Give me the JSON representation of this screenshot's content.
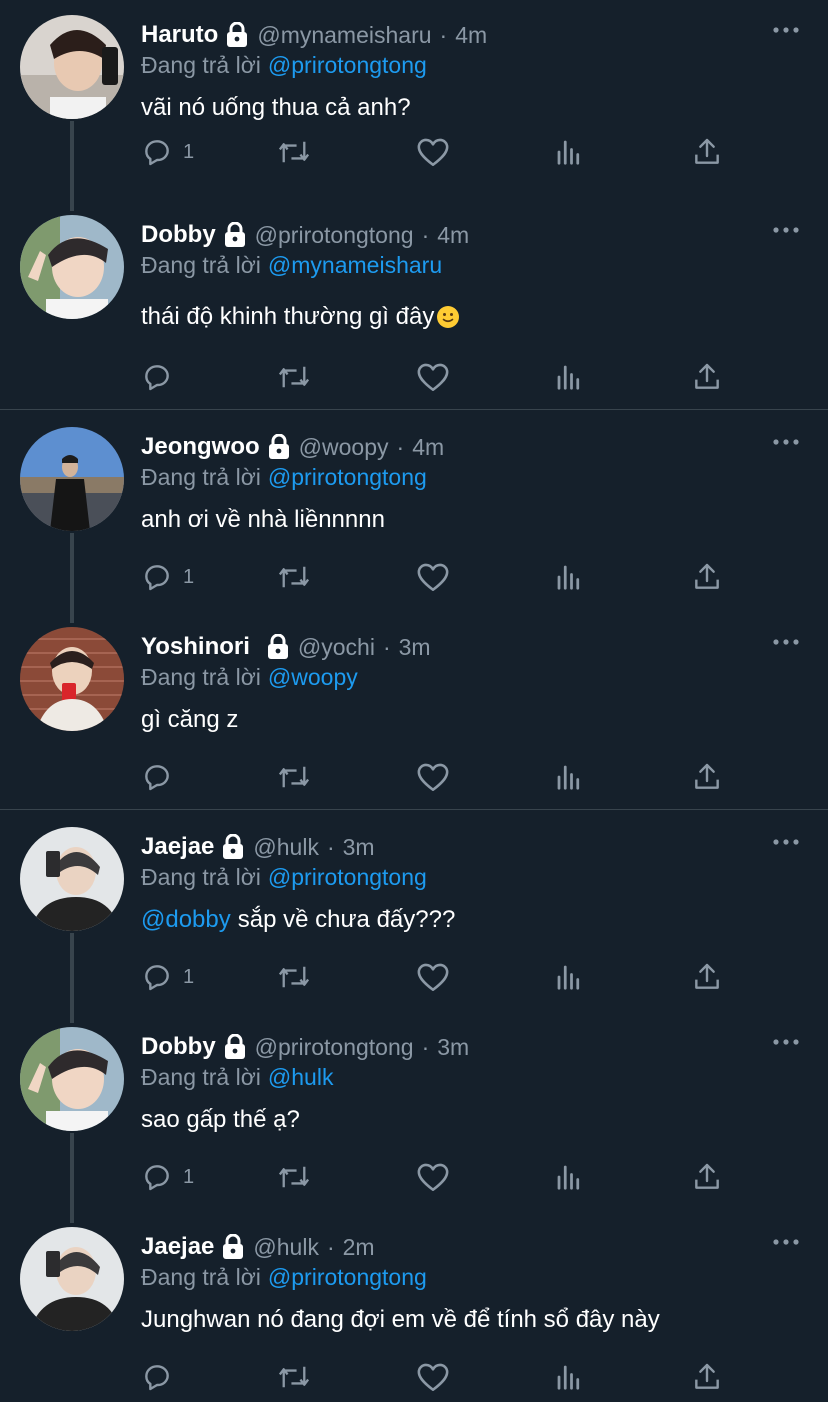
{
  "colors": {
    "background": "#15202b",
    "accent": "#1d9bf0",
    "secondary_text": "#8b98a5",
    "divider": "#38444d"
  },
  "reply_prefix": "Đang trả lời",
  "tweets": [
    {
      "name": "Haruto",
      "handle": "@mynameisharu",
      "time": "4m",
      "replying_to": "@prirotongtong",
      "text": "vãi nó uống thua cả anh?",
      "reply_count": "1"
    },
    {
      "name": "Dobby",
      "handle": "@prirotongtong",
      "time": "4m",
      "replying_to": "@mynameisharu",
      "text": "thái độ khinh thường gì đây",
      "text_emoji": "slightly-smiling-face",
      "reply_count": ""
    },
    {
      "name": "Jeongwoo",
      "handle": "@woopy",
      "time": "4m",
      "replying_to": "@prirotongtong",
      "text": "anh ơi về nhà liềnnnnn",
      "reply_count": "1"
    },
    {
      "name": "Yoshinori",
      "handle": "@yochi",
      "time": "3m",
      "replying_to": "@woopy",
      "text": "gì căng z",
      "reply_count": ""
    },
    {
      "name": "Jaejae",
      "handle": "@hulk",
      "time": "3m",
      "replying_to": "@prirotongtong",
      "text_mention": "@dobby",
      "text": "sắp về chưa đấy???",
      "reply_count": "1"
    },
    {
      "name": "Dobby",
      "handle": "@prirotongtong",
      "time": "3m",
      "replying_to": "@hulk",
      "text": "sao gấp thế ạ?",
      "reply_count": "1"
    },
    {
      "name": "Jaejae",
      "handle": "@hulk",
      "time": "2m",
      "replying_to": "@prirotongtong",
      "text": "Junghwan nó đang đợi em về để tính sổ đây này",
      "reply_count": ""
    }
  ]
}
